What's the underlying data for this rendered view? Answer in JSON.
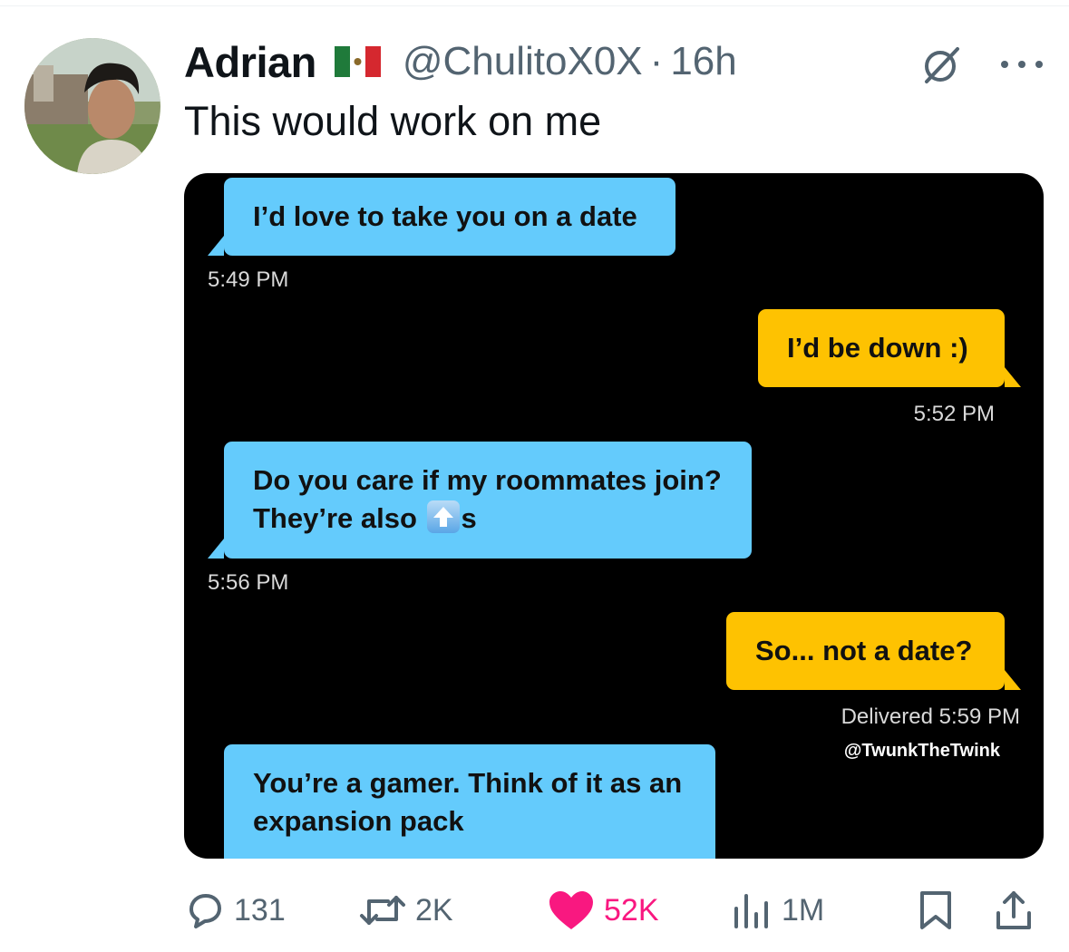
{
  "user": {
    "name": "Adrian",
    "flag_icon": "mexico-flag-icon",
    "handle": "@ChulitoX0X",
    "separator": "·",
    "time": "16h"
  },
  "tweet": {
    "text": "This would work on me"
  },
  "conversation": {
    "messages": [
      {
        "side": "incoming",
        "text": "I’d love to take you on a date",
        "time": "5:49 PM"
      },
      {
        "side": "outgoing",
        "text": "I’d be down :)",
        "time": "5:52 PM"
      },
      {
        "side": "incoming",
        "line1": "Do you care if my roommates join?",
        "line2_prefix": "They’re also ",
        "emoji": "up-arrow-emoji",
        "line2_suffix": "s",
        "time": "5:56 PM"
      },
      {
        "side": "outgoing",
        "text": "So... not a date?",
        "time": "Delivered 5:59 PM"
      },
      {
        "side": "incoming",
        "line1": "You’re a gamer. Think of it as an",
        "line2": "expansion pack"
      }
    ],
    "credit": "@TwunkTheTwink",
    "colors": {
      "incoming": "#64cbfc",
      "outgoing": "#fec201",
      "background": "#000000"
    }
  },
  "actions": {
    "replies": "131",
    "reposts": "2K",
    "likes": "52K",
    "views": "1M",
    "like_color": "#f91880"
  }
}
